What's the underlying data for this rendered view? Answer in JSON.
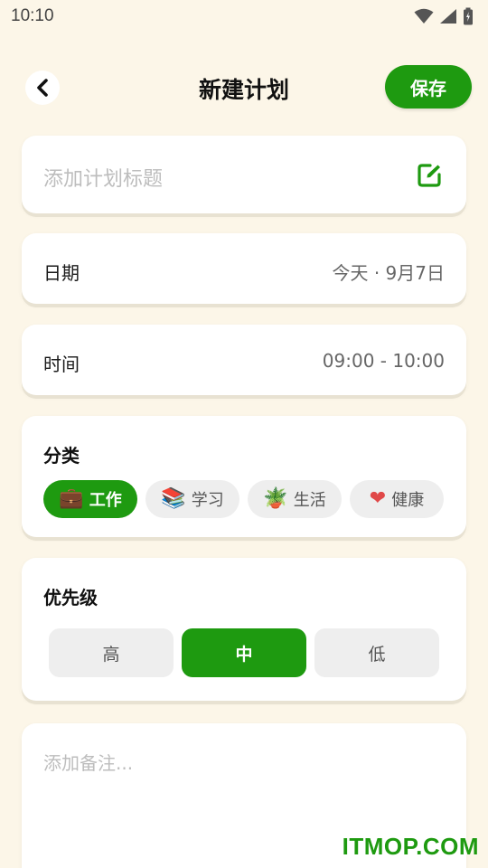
{
  "status_bar": {
    "time": "10:10",
    "icons": [
      "wifi-icon",
      "signal-icon",
      "battery-icon"
    ]
  },
  "header": {
    "title": "新建计划",
    "back_icon": "chevron-left-icon",
    "save_label": "保存"
  },
  "plan_title": {
    "placeholder": "添加计划标题",
    "icon": "edit-icon"
  },
  "date_row": {
    "label": "日期",
    "value": "今天 · 9月7日"
  },
  "time_row": {
    "label": "时间",
    "value": "09:00 - 10:00"
  },
  "category": {
    "title": "分类",
    "chips": [
      {
        "label": "工作",
        "emoji": "💼",
        "icon": "briefcase-icon",
        "selected": true
      },
      {
        "label": "学习",
        "emoji": "📚",
        "icon": "books-icon",
        "selected": false
      },
      {
        "label": "生活",
        "emoji": "🪴",
        "icon": "potted-plant-icon",
        "selected": false
      },
      {
        "label": "健康",
        "emoji": "❤",
        "icon": "heart-icon",
        "selected": false
      }
    ]
  },
  "priority": {
    "title": "优先级",
    "options": [
      {
        "label": "高",
        "selected": false
      },
      {
        "label": "中",
        "selected": true
      },
      {
        "label": "低",
        "selected": false
      }
    ]
  },
  "note": {
    "placeholder": "添加备注..."
  },
  "watermark": "ITMOP.COM",
  "colors": {
    "accent": "#1e9a10",
    "background": "#fcf6e8",
    "card": "#ffffff",
    "chip": "#eeeeee"
  }
}
